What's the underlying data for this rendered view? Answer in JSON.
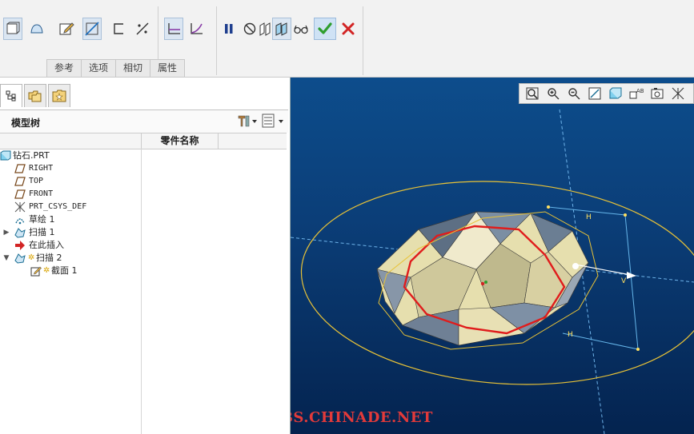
{
  "ribbon": {
    "tabs": [
      "参考",
      "选项",
      "相切",
      "属性"
    ],
    "tools": [
      "solid-icon",
      "surface-icon",
      "sketch-edit-icon",
      "trajectory-icon",
      "open-section-icon",
      "constant-section-icon",
      "normal-to-trajectory-icon",
      "variable-section-icon",
      "pause-icon",
      "no-preview-icon",
      "attached-preview-icon",
      "verify-glasses-icon",
      "apply-check-icon",
      "cancel-x-icon"
    ],
    "colors": {
      "pause": "#1f3f8f",
      "apply": "#2e9e2e",
      "cancel": "#d22424"
    }
  },
  "model_tree": {
    "title": "模型树",
    "column_header": "零件名称",
    "items": [
      {
        "label": "钻石.PRT",
        "icon": "part-icon",
        "expander": ""
      },
      {
        "label": "RIGHT",
        "icon": "datum-plane-icon",
        "expander": ""
      },
      {
        "label": "TOP",
        "icon": "datum-plane-icon",
        "expander": ""
      },
      {
        "label": "FRONT",
        "icon": "datum-plane-icon",
        "expander": ""
      },
      {
        "label": "PRT_CSYS_DEF",
        "icon": "csys-icon",
        "expander": ""
      },
      {
        "label": "草绘 1",
        "icon": "sketch-icon",
        "expander": ""
      },
      {
        "label": "扫描 1",
        "icon": "sweep-icon",
        "expander": "▶"
      },
      {
        "label": "在此插入",
        "icon": "insert-here-icon",
        "expander": ""
      },
      {
        "label": "扫描 2",
        "icon": "sweep-icon",
        "expander": "▼"
      },
      {
        "label": "截面 1",
        "icon": "section-icon",
        "expander": ""
      }
    ]
  },
  "viewport": {
    "toolbar": [
      "refit-icon",
      "zoom-in-icon",
      "zoom-out-icon",
      "repaint-icon",
      "display-style-icon",
      "saved-views-icon",
      "view-manager-icon",
      "datum-display-icon"
    ],
    "labels": {
      "h1": "H",
      "h2": "H",
      "v": "V"
    },
    "watermark": "BBS.CHINADE.NET",
    "background": "#0b3e78"
  }
}
